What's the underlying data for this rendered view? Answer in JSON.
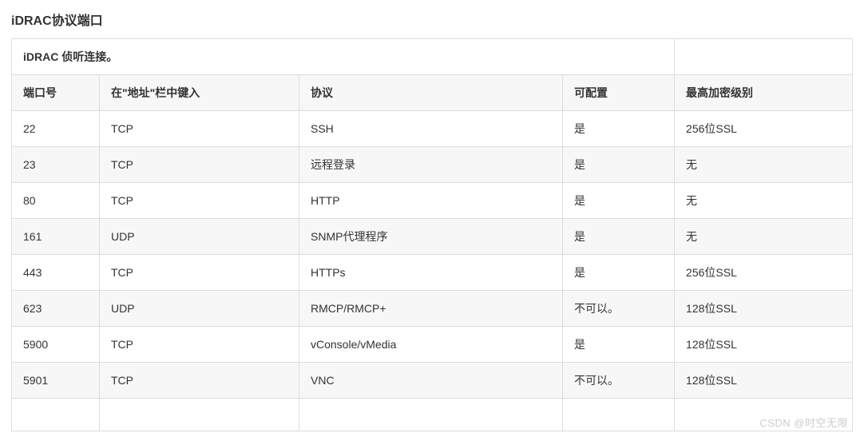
{
  "title": "iDRAC协议端口",
  "caption": "iDRAC 侦听连接。",
  "headers": {
    "port": "端口号",
    "address": "在\"地址\"栏中键入",
    "protocol": "协议",
    "configurable": "可配置",
    "encryption": "最高加密级别"
  },
  "rows": [
    {
      "port": "22",
      "address": "TCP",
      "protocol": "SSH",
      "configurable": "是",
      "encryption": "256位SSL"
    },
    {
      "port": "23",
      "address": "TCP",
      "protocol": "远程登录",
      "configurable": "是",
      "encryption": "无"
    },
    {
      "port": "80",
      "address": "TCP",
      "protocol": "HTTP",
      "configurable": "是",
      "encryption": "无"
    },
    {
      "port": "161",
      "address": "UDP",
      "protocol": "SNMP代理程序",
      "configurable": "是",
      "encryption": "无"
    },
    {
      "port": "443",
      "address": "TCP",
      "protocol": "HTTPs",
      "configurable": "是",
      "encryption": "256位SSL"
    },
    {
      "port": "623",
      "address": "UDP",
      "protocol": "RMCP/RMCP+",
      "configurable": "不可以。",
      "encryption": "128位SSL"
    },
    {
      "port": "5900",
      "address": "TCP",
      "protocol": "vConsole/vMedia",
      "configurable": "是",
      "encryption": "128位SSL"
    },
    {
      "port": "5901",
      "address": "TCP",
      "protocol": "VNC",
      "configurable": "不可以。",
      "encryption": "128位SSL"
    }
  ],
  "empty_rows": 1,
  "watermark": "CSDN @时空无限",
  "chart_data": {
    "type": "table",
    "title": "iDRAC协议端口",
    "columns": [
      "端口号",
      "在\"地址\"栏中键入",
      "协议",
      "可配置",
      "最高加密级别"
    ],
    "data": [
      [
        "22",
        "TCP",
        "SSH",
        "是",
        "256位SSL"
      ],
      [
        "23",
        "TCP",
        "远程登录",
        "是",
        "无"
      ],
      [
        "80",
        "TCP",
        "HTTP",
        "是",
        "无"
      ],
      [
        "161",
        "UDP",
        "SNMP代理程序",
        "是",
        "无"
      ],
      [
        "443",
        "TCP",
        "HTTPs",
        "是",
        "256位SSL"
      ],
      [
        "623",
        "UDP",
        "RMCP/RMCP+",
        "不可以。",
        "128位SSL"
      ],
      [
        "5900",
        "TCP",
        "vConsole/vMedia",
        "是",
        "128位SSL"
      ],
      [
        "5901",
        "TCP",
        "VNC",
        "不可以。",
        "128位SSL"
      ]
    ]
  }
}
